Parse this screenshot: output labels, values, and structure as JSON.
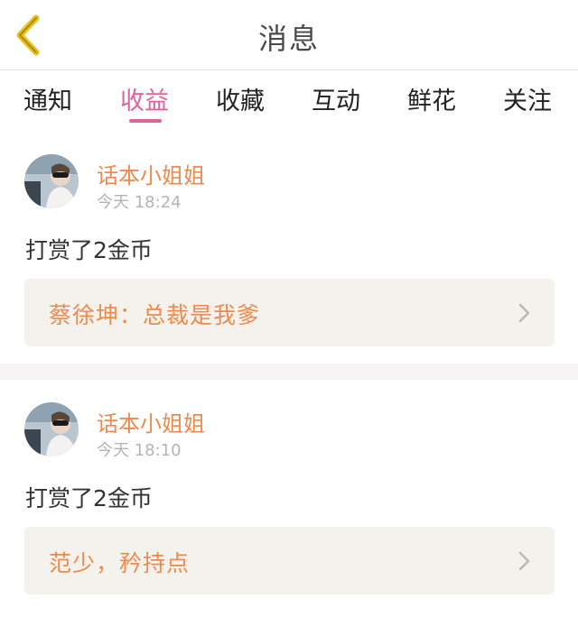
{
  "header": {
    "title": "消息",
    "back_icon": "chevron-left-icon",
    "back_color": "#e8c01a"
  },
  "tabs": [
    {
      "label": "通知",
      "active": false
    },
    {
      "label": "收益",
      "active": true
    },
    {
      "label": "收藏",
      "active": false
    },
    {
      "label": "互动",
      "active": false
    },
    {
      "label": "鲜花",
      "active": false
    },
    {
      "label": "关注",
      "active": false
    }
  ],
  "colors": {
    "accent_pink": "#e0629d",
    "accent_orange": "#f0894d",
    "time_gray": "#b4b4b4",
    "card_bg": "#f4f2ec"
  },
  "messages": [
    {
      "username": "话本小姐姐",
      "time": "今天 18:24",
      "text": "打赏了2金币",
      "work_title": "蔡徐坤：总裁是我爹",
      "link_icon": "chevron-right-icon"
    },
    {
      "username": "话本小姐姐",
      "time": "今天 18:10",
      "text": "打赏了2金币",
      "work_title": "范少，矜持点",
      "link_icon": "chevron-right-icon"
    }
  ]
}
